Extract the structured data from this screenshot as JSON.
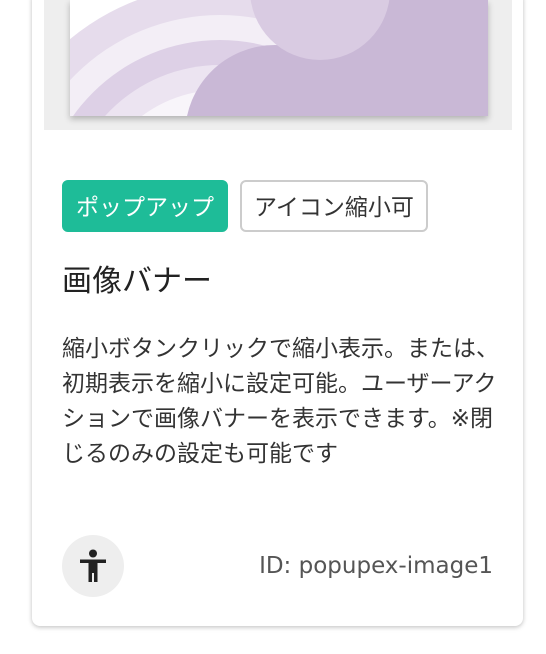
{
  "card": {
    "tags": [
      {
        "label": "ポップアップ",
        "style": "primary"
      },
      {
        "label": "アイコン縮小可",
        "style": "outline"
      }
    ],
    "title": "画像バナー",
    "description": "縮小ボタンクリックで縮小表示。または、初期表示を縮小に設定可能。ユーザーアクションで画像バナーを表示できます。※閉じるのみの設定も可能です",
    "id_text": "ID: popupex-image1",
    "accessibility_icon": "accessibility-icon"
  },
  "colors": {
    "primary_tag": "#1ebc98",
    "preview_purple": "#c9b8d6",
    "preview_light_purple": "#e2d6ea",
    "icon_bg": "#eeeeee"
  }
}
